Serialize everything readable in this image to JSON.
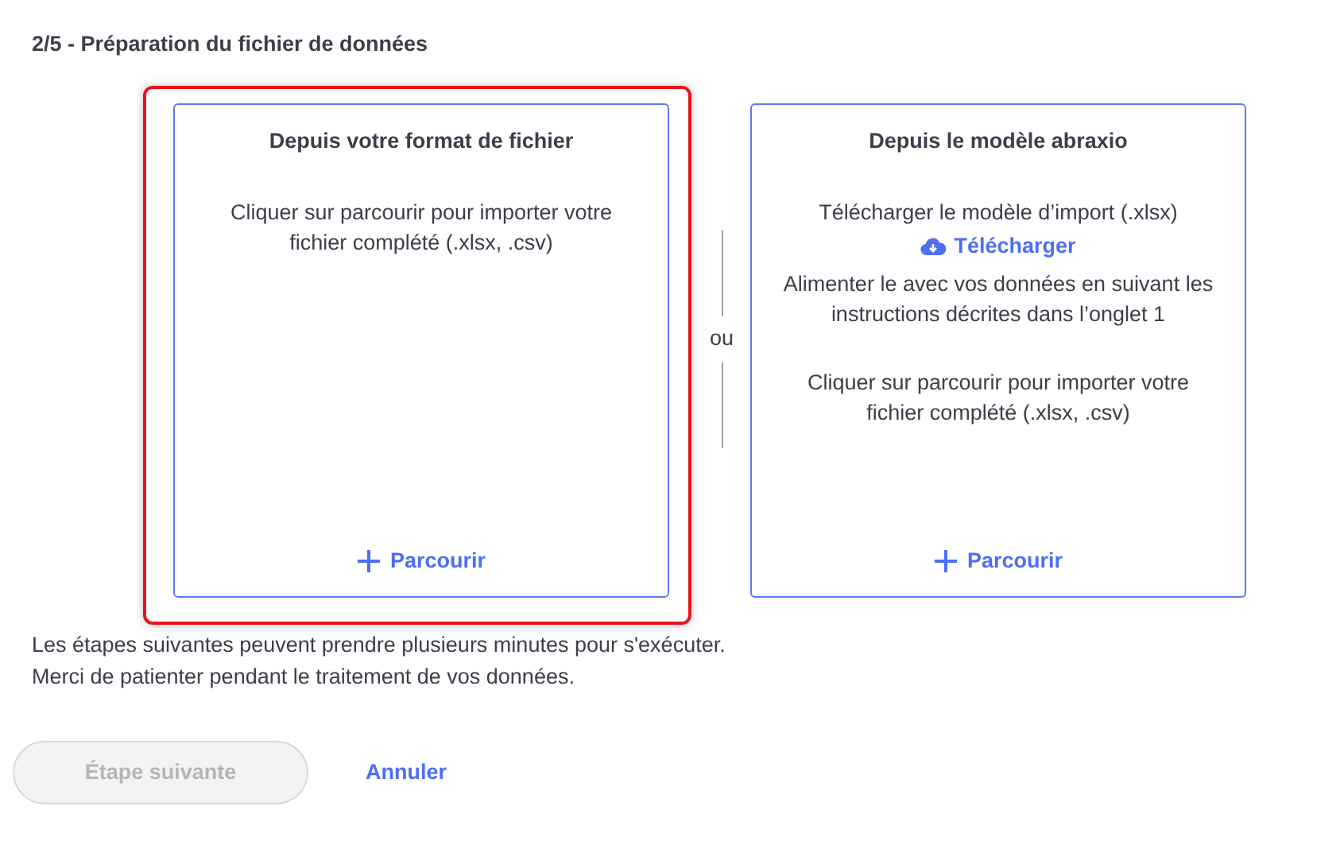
{
  "step_title": "2/5 - Préparation du fichier de données",
  "panels": [
    {
      "title": "Depuis votre format de fichier",
      "selected": true,
      "items": [
        {
          "kind": "text",
          "text": "Cliquer sur parcourir pour importer votre fichier complété (.xlsx, .csv)"
        }
      ],
      "browse": "Parcourir"
    },
    {
      "title": "Depuis le modèle abraxio",
      "selected": false,
      "items": [
        {
          "kind": "text",
          "text": "Télécharger le modèle d’import (.xlsx)"
        },
        {
          "kind": "download",
          "text": "Télécharger"
        },
        {
          "kind": "text",
          "text": "Alimenter le avec vos données en suivant les instructions décrites dans l’onglet 1"
        },
        {
          "kind": "spacer"
        },
        {
          "kind": "text",
          "text": "Cliquer sur parcourir pour importer votre fichier complété (.xlsx, .csv)"
        }
      ],
      "browse": "Parcourir"
    }
  ],
  "separator": "ou",
  "notes": [
    "Les étapes suivantes peuvent prendre plusieurs minutes pour s'exécuter.",
    "Merci de patienter pendant le traitement de vos données."
  ],
  "next_button": {
    "label": "Étape suivante",
    "disabled": true
  },
  "cancel_link": "Annuler"
}
